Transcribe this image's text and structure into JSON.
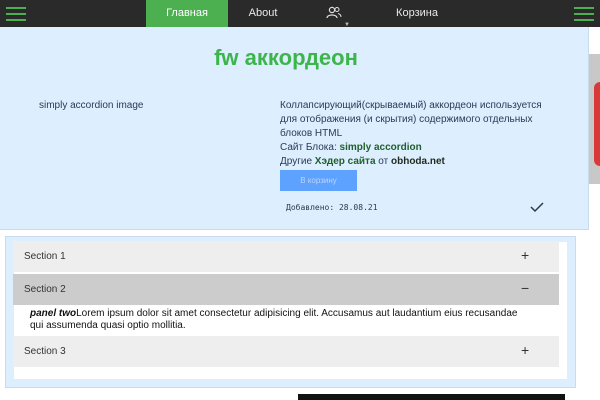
{
  "nav": {
    "items": [
      {
        "label": "Главная"
      },
      {
        "label": "About"
      },
      {
        "label": ""
      },
      {
        "label": "Корзина"
      }
    ]
  },
  "card": {
    "title": "fw аккордеон",
    "image_alt": "simply accordion image",
    "desc_line1": "Коллапсирующий(скрываемый) аккордеон используется для отображения (и скрытия) содержимого отдельных блоков HTML",
    "site_prefix": "Сайт Блока: ",
    "site_name": "simply accordion",
    "other_prefix": "Другие ",
    "other_link": "Хэдер сайта",
    "other_mid": " от ",
    "other_site": "obhoda.net",
    "cart_button": "В корзину",
    "added": "Добавлено: 28.08.21"
  },
  "accordion": {
    "sections": [
      {
        "label": "Section 1",
        "sign": "+"
      },
      {
        "label": "Section 2",
        "sign": "−"
      },
      {
        "label": "Section 3",
        "sign": "+"
      }
    ],
    "panel_title": "panel two",
    "panel_text": "Lorem ipsum dolor sit amet consectetur adipisicing elit. Accusamus aut laudantium eius recusandae qui assumenda quasi optio mollitia."
  },
  "colors": {
    "accent": "#4caf50",
    "nav_bg": "#2a2a2a",
    "card_bg": "#ddeeff",
    "button": "#5ea2ff"
  }
}
